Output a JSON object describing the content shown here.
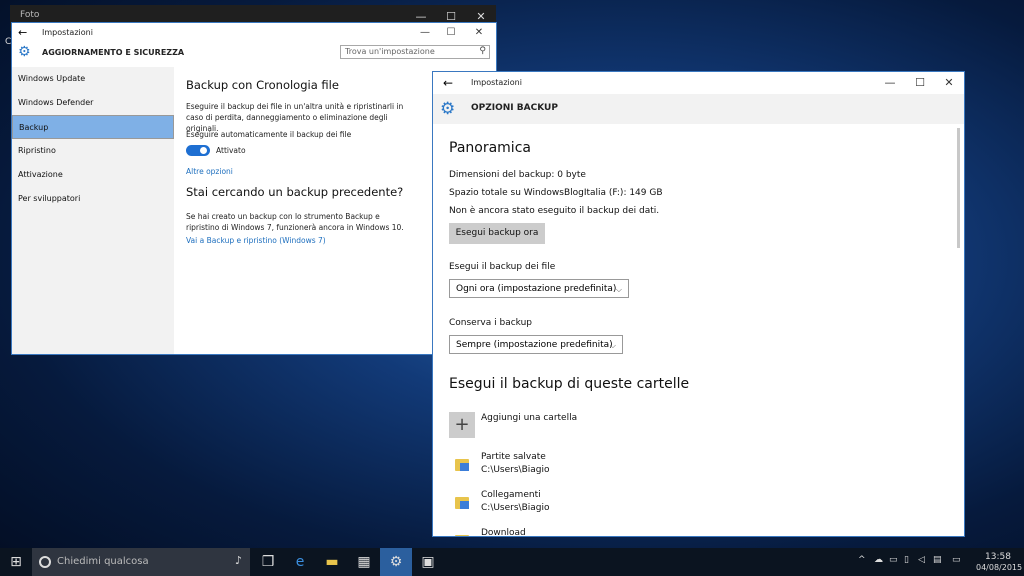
{
  "foto_window": {
    "title": "Foto",
    "strip_letter": "C"
  },
  "settings": {
    "window_title": "Impostazioni",
    "section_title": "AGGIORNAMENTO E SICUREZZA",
    "search_placeholder": "Trova un'impostazione",
    "sidebar": [
      {
        "label": "Windows Update",
        "selected": false
      },
      {
        "label": "Windows Defender",
        "selected": false
      },
      {
        "label": "Backup",
        "selected": true
      },
      {
        "label": "Ripristino",
        "selected": false
      },
      {
        "label": "Attivazione",
        "selected": false
      },
      {
        "label": "Per sviluppatori",
        "selected": false
      }
    ],
    "backup": {
      "heading": "Backup con Cronologia file",
      "description": "Eseguire il backup dei file in un'altra unità e ripristinarli in caso di perdita, danneggiamento o eliminazione degli originali.",
      "auto_label": "Eseguire automaticamente il backup dei file",
      "toggle_state": "Attivato",
      "more_options": "Altre opzioni",
      "heading2": "Stai cercando un backup precedente?",
      "desc2": "Se hai creato un backup con lo strumento Backup e ripristino di Windows 7, funzionerà ancora in Windows 10.",
      "link2": "Vai a Backup e ripristino (Windows 7)"
    }
  },
  "backup_options": {
    "window_title": "Impostazioni",
    "header": "OPZIONI BACKUP",
    "overview_title": "Panoramica",
    "size": "Dimensioni del backup: 0 byte",
    "space": "Spazio totale su WindowsBlogItalia (F:): 149 GB",
    "status": "Non è ancora stato eseguito il backup dei dati.",
    "backup_now": "Esegui backup ora",
    "freq_label": "Esegui il backup dei file",
    "freq_value": "Ogni ora (impostazione predefinita)",
    "keep_label": "Conserva i backup",
    "keep_value": "Sempre (impostazione predefinita)",
    "folders_title": "Esegui il backup di queste cartelle",
    "add_folder": "Aggiungi una cartella",
    "folders": [
      {
        "name": "Partite salvate",
        "path": "C:\\Users\\Biagio"
      },
      {
        "name": "Collegamenti",
        "path": "C:\\Users\\Biagio"
      },
      {
        "name": "Download",
        "path": ""
      }
    ]
  },
  "taskbar": {
    "search_placeholder": "Chiedimi qualcosa",
    "time": "13:58",
    "date": "04/08/2015"
  }
}
